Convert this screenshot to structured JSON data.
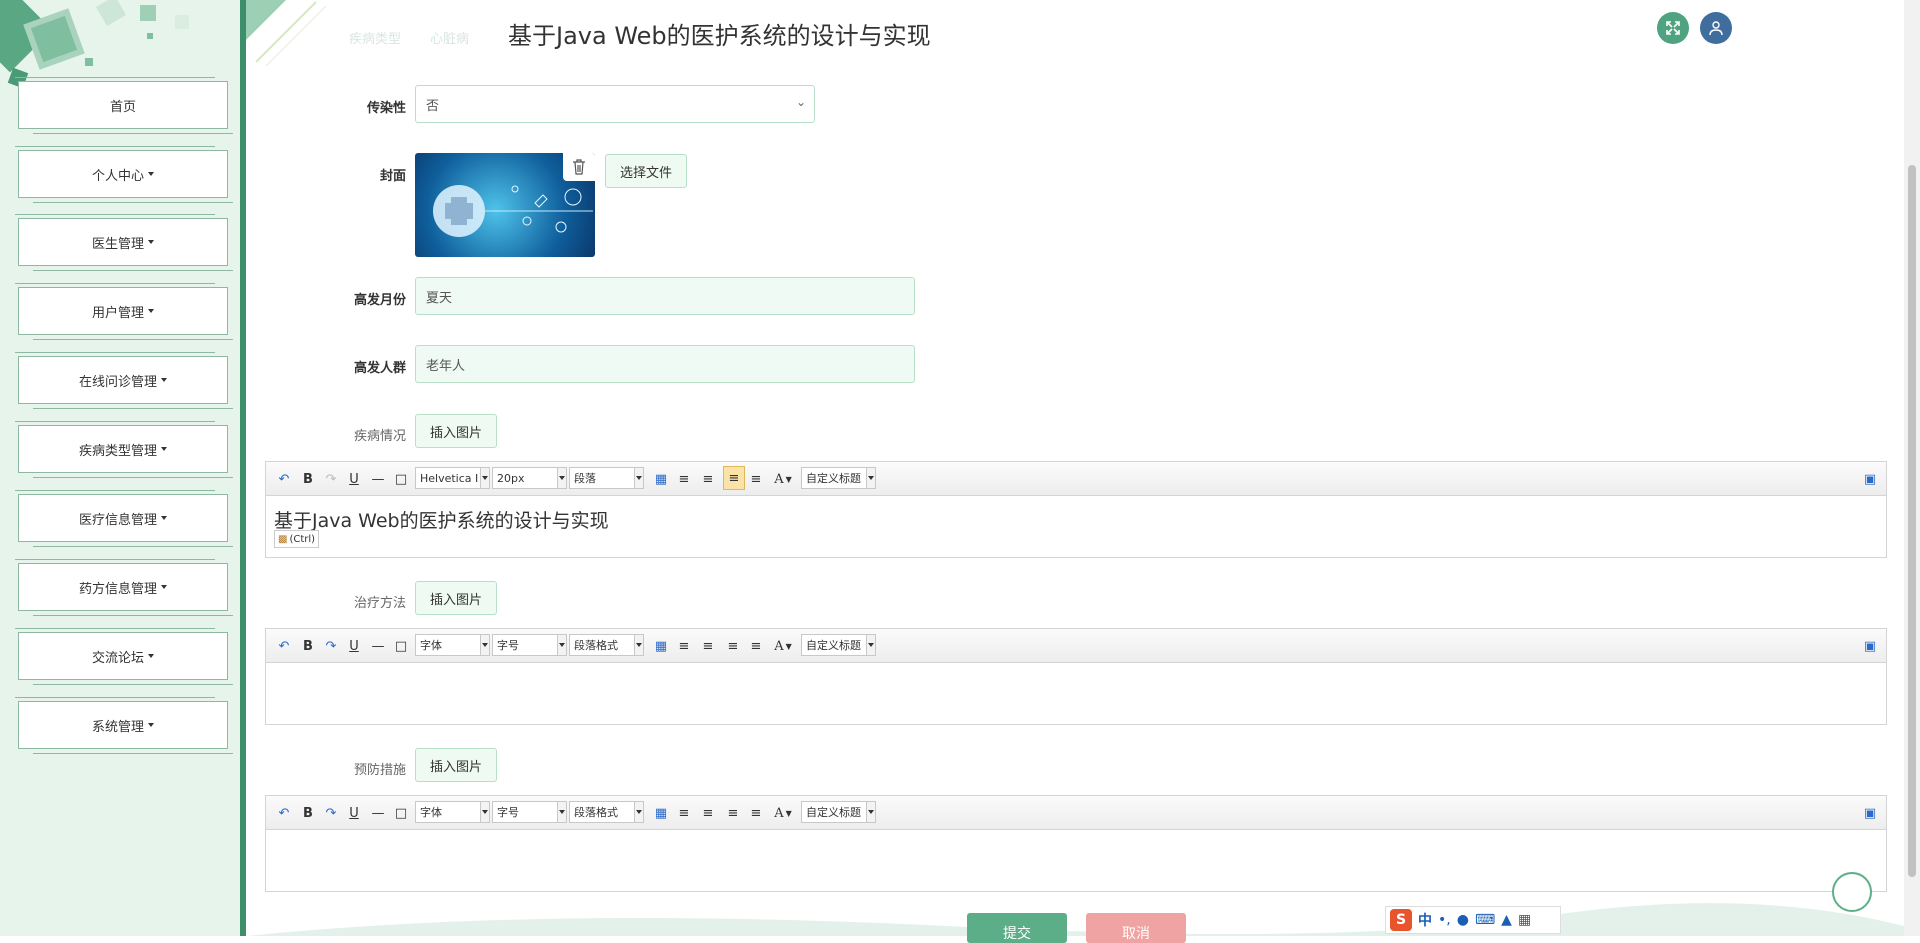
{
  "app": {
    "title": "基于Java Web的医护系统的设计与实现"
  },
  "sidebar": {
    "items": [
      {
        "label": "首页",
        "has_caret": false
      },
      {
        "label": "个人中心",
        "has_caret": true
      },
      {
        "label": "医生管理",
        "has_caret": true
      },
      {
        "label": "用户管理",
        "has_caret": true
      },
      {
        "label": "在线问诊管理",
        "has_caret": true
      },
      {
        "label": "疾病类型管理",
        "has_caret": true
      },
      {
        "label": "医疗信息管理",
        "has_caret": true
      },
      {
        "label": "药方信息管理",
        "has_caret": true
      },
      {
        "label": "交流论坛",
        "has_caret": true
      },
      {
        "label": "系统管理",
        "has_caret": true
      }
    ]
  },
  "header": {
    "ghost_label": "疾病类型",
    "ghost_value": "心脏病",
    "fullscreen_icon": "expand-icon",
    "user_icon": "user-icon"
  },
  "form": {
    "contagious": {
      "label": "传染性",
      "value": "否"
    },
    "cover": {
      "label": "封面",
      "choose_file": "选择文件",
      "delete_icon": "trash-icon"
    },
    "peak_month": {
      "label": "高发月份",
      "value": "夏天"
    },
    "peak_group": {
      "label": "高发人群",
      "value": "老年人"
    },
    "condition": {
      "label": "疾病情况",
      "insert_image": "插入图片",
      "content": "基于Java Web的医护系统的设计与实现",
      "paste_hint": "(Ctrl)"
    },
    "treatment": {
      "label": "治疗方法",
      "insert_image": "插入图片"
    },
    "prevention": {
      "label": "预防措施",
      "insert_image": "插入图片"
    }
  },
  "editor_toolbar": {
    "active": {
      "font": "Helvetica I",
      "size": "20px",
      "format": "段落",
      "custom": "自定义标题"
    },
    "default": {
      "font": "字体",
      "size": "字号",
      "format": "段落格式",
      "custom": "自定义标题"
    },
    "bold": "B",
    "underline": "U",
    "color": "A"
  },
  "actions": {
    "submit": "提交",
    "cancel": "取消"
  },
  "ime": {
    "mode": "中"
  },
  "colors": {
    "accent": "#3d8e6a",
    "sidebar_bg": "#e6f4ec",
    "submit": "#5cae88",
    "cancel": "#f0a3a3",
    "avatar": "#3f6d9e"
  }
}
